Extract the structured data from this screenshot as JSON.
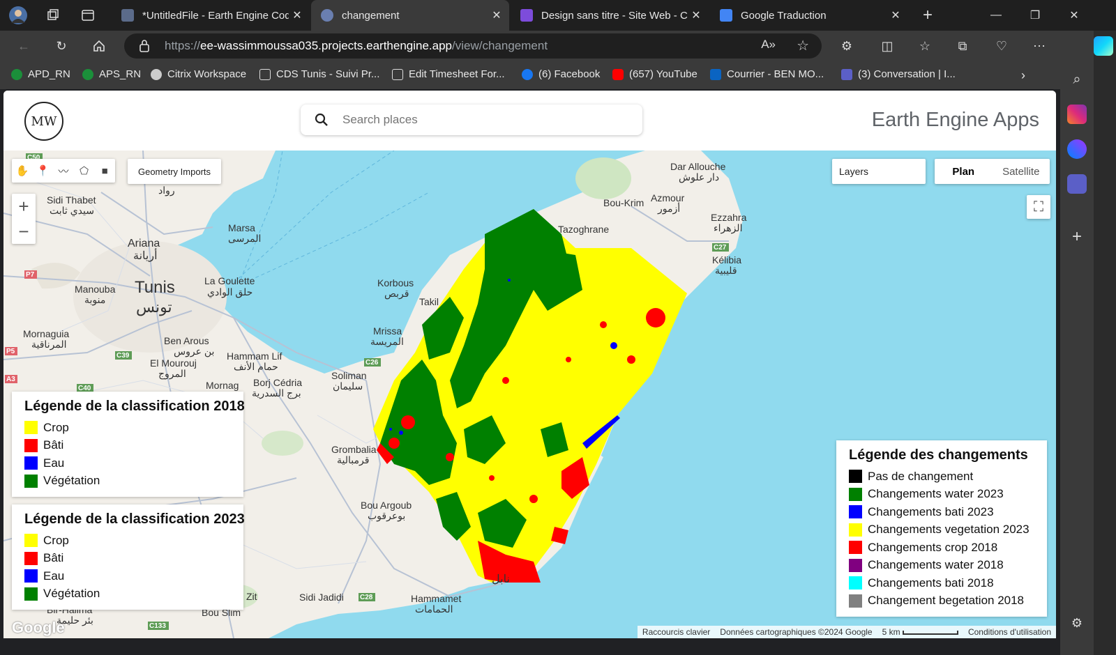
{
  "browser": {
    "tabs": [
      {
        "title": "*UntitledFile - Earth Engine Code",
        "active": false
      },
      {
        "title": "changement",
        "active": true
      },
      {
        "title": "Design sans titre - Site Web - Canva",
        "active": false
      },
      {
        "title": "Google Traduction",
        "active": false
      }
    ],
    "url_scheme": "https://",
    "url_host": "ee-wassimmoussa035.projects.earthengine.app",
    "url_path": "/view/changement",
    "bookmarks": [
      "APD_RN",
      "APS_RN",
      "Citrix Workspace",
      "CDS Tunis - Suivi Pr...",
      "Edit Timesheet For...",
      "(6) Facebook",
      "(657) YouTube",
      "Courrier - BEN MO...",
      "(3) Conversation | I..."
    ]
  },
  "app": {
    "logo_text": "MW",
    "search_placeholder": "Search places",
    "brand": "Earth Engine Apps"
  },
  "map": {
    "geometry_imports": "Geometry Imports",
    "layers_label": "Layers",
    "plan_label": "Plan",
    "satellite_label": "Satellite",
    "labels": {
      "tunis": "Tunis",
      "tunis_ar": "تونس",
      "ariana": "Ariana",
      "ariana_ar": "أريانة",
      "sidi_thabet": "Sidi Thabet",
      "sidi_thabet_ar": "سيدي ثابت",
      "marsa": "Marsa",
      "marsa_ar": "المرسى",
      "manouba": "Manouba",
      "manouba_ar": "منوبة",
      "la_goulette": "La Goulette",
      "la_goulette_ar": "حلق الوادي",
      "mornaguia": "Mornaguia",
      "mornaguia_ar": "المرناقية",
      "ben_arous": "Ben Arous",
      "ben_arous_ar": "بن عروس",
      "el_mourouj": "El Mourouj",
      "el_mourouj_ar": "المروج",
      "hammam_lif": "Hammam Lif",
      "hammam_lif_ar": "حمام الأنف",
      "mornag": "Mornag",
      "borj_cedria": "Borj Cédria",
      "borj_cedria_ar": "برج السدرية",
      "soliman": "Soliman",
      "soliman_ar": "سليمان",
      "grombalia": "Grombalia",
      "grombalia_ar": "قرمبالية",
      "bou_argoub": "Bou Argoub",
      "bou_argoub_ar": "بوعرقوب",
      "korbous": "Korbous",
      "korbous_ar": "قربص",
      "mrissa": "Mrissa",
      "mrissa_ar": "المريسة",
      "dar_allouche": "Dar Allouche",
      "dar_allouche_ar": "دار علوش",
      "bou_krim": "Bou-Krim",
      "azmour": "Azmour",
      "azmour_ar": "أزمور",
      "tazoghrane": "Tazoghrane",
      "ezzahra": "Ezzahra",
      "ezzahra_ar": "الزهراء",
      "kelibia": "Kélibia",
      "kelibia_ar": "قليبية",
      "hammamet": "Hammamet",
      "hammamet_ar": "الحمامات",
      "sidi_jadidi": "Sidi Jadidi",
      "bou_slim": "Bou Slim",
      "bir_halima": "Bir-Halima",
      "bir_halima_ar": "بئر حليمة",
      "zit": "Zit",
      "nabeul_ar": "نابل",
      "takil": "Takil",
      "rouad_ar": "رواد"
    },
    "road_labels": [
      "P7",
      "C39",
      "C26",
      "C27",
      "C28",
      "C133",
      "A3",
      "C40",
      "P5",
      "C50"
    ],
    "attribution": {
      "shortcuts": "Raccourcis clavier",
      "data": "Données cartographiques ©2024 Google",
      "scale": "5 km",
      "terms": "Conditions d'utilisation"
    }
  },
  "legend_2018": {
    "title": "Légende de la classification 2018",
    "items": [
      {
        "label": "Crop",
        "color": "#ffff00"
      },
      {
        "label": "Bâti",
        "color": "#ff0000"
      },
      {
        "label": "Eau",
        "color": "#0000ff"
      },
      {
        "label": "Végétation",
        "color": "#008000"
      }
    ]
  },
  "legend_2023": {
    "title": "Légende de la classification 2023",
    "items": [
      {
        "label": "Crop",
        "color": "#ffff00"
      },
      {
        "label": "Bâti",
        "color": "#ff0000"
      },
      {
        "label": "Eau",
        "color": "#0000ff"
      },
      {
        "label": "Végétation",
        "color": "#008000"
      }
    ]
  },
  "legend_changes": {
    "title": "Légende des changements",
    "items": [
      {
        "label": "Pas de changement",
        "color": "#000000"
      },
      {
        "label": "Changements water 2023",
        "color": "#008000"
      },
      {
        "label": "Changements bati 2023",
        "color": "#0000ff"
      },
      {
        "label": "Changements vegetation 2023",
        "color": "#ffff00"
      },
      {
        "label": "Changements crop 2018",
        "color": "#ff0000"
      },
      {
        "label": "Changements water 2018",
        "color": "#800080"
      },
      {
        "label": "Changements bati 2018",
        "color": "#00ffff"
      },
      {
        "label": "Changement begetation 2018",
        "color": "#808080"
      }
    ]
  }
}
